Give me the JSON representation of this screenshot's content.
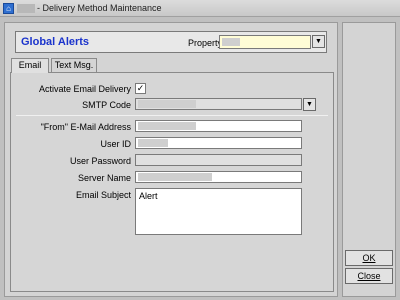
{
  "window": {
    "title": "- Delivery Method Maintenance",
    "icon": "app-icon"
  },
  "header": {
    "title": "Global Alerts",
    "property_label": "Property",
    "property_value": ""
  },
  "tabs": [
    {
      "label": "Email",
      "active": true
    },
    {
      "label": "Text Msg.",
      "active": false
    }
  ],
  "form": {
    "activate_label": "Activate Email Delivery",
    "activate_checked": "✓",
    "smtp_label": "SMTP Code",
    "smtp_value": "",
    "from_label": "\"From\" E-Mail Address",
    "from_value": "",
    "userid_label": "User ID",
    "userid_value": "",
    "password_label": "User Password",
    "password_value": "",
    "server_label": "Server Name",
    "server_value": "",
    "subject_label": "Email Subject",
    "subject_value": "Alert"
  },
  "buttons": {
    "ok": "OK",
    "close": "Close"
  },
  "colors": {
    "accent": "#1a33cc",
    "property_field": "#fffdd6"
  }
}
